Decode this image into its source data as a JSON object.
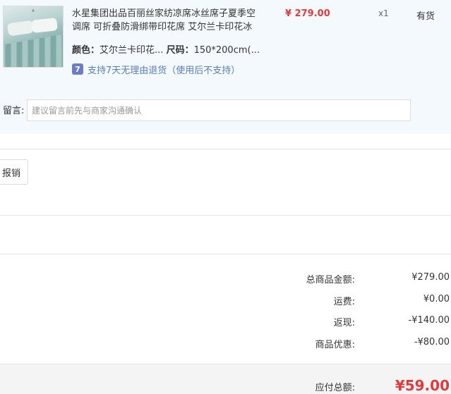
{
  "product": {
    "title": "水星集团出品百丽丝家纺凉席冰丝席子夏季空调席 可折叠防滑绑带印花席 艾尔兰卡印花冰",
    "price": "¥ 279.00",
    "quantity": "x1",
    "stock_status": "有货",
    "color_label": "颜色：",
    "color_value": "艾尔兰卡印花...",
    "size_label": "尺码：",
    "size_value": "150*200cm(...",
    "return_icon": "7",
    "return_policy": "支持7天无理由退货（使用后不支持）",
    "image_icon": "bed-mat-product-image"
  },
  "message": {
    "label": "留言:",
    "placeholder": "建议留言前先与商家沟通确认"
  },
  "invoice": {
    "button_label": "报销"
  },
  "summary": {
    "goods_total_label": "总商品金额:",
    "goods_total_value": "¥279.00",
    "shipping_label": "运费:",
    "shipping_value": "¥0.00",
    "cashback_label": "返现:",
    "cashback_value": "-¥140.00",
    "discount_label": "商品优惠:",
    "discount_value": "-¥80.00",
    "payable_label": "应付总额:",
    "payable_value": "¥59.00"
  },
  "colors": {
    "accent_red": "#e4393c",
    "link_blue": "#5b7bb8",
    "section_bg": "#f3f9fd"
  }
}
